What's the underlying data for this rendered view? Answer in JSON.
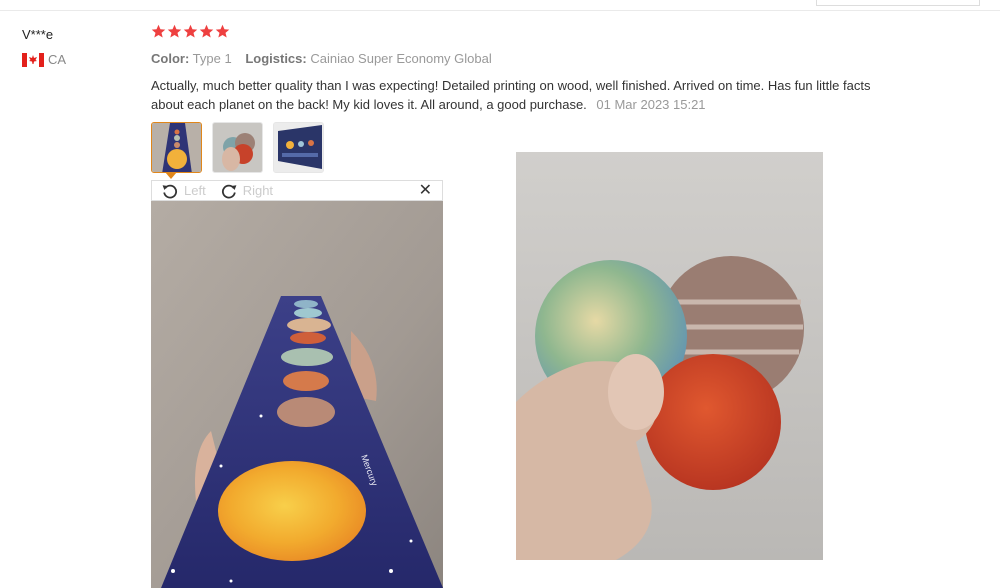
{
  "reviewer": {
    "name": "V***e",
    "country": "CA"
  },
  "review": {
    "rating": 5,
    "color_label": "Color:",
    "color_value": "Type 1",
    "logistics_label": "Logistics:",
    "logistics_value": "Cainiao Super Economy Global",
    "text": "Actually, much better quality than I was expecting! Detailed printing on wood, well finished. Arrived on time. Has fun little facts about each planet on the back! My kid loves it. All around, a good purchase.",
    "date": "01 Mar 2023 15:21"
  },
  "viewer": {
    "left_label": "Left",
    "right_label": "Right",
    "close_label": "✕"
  },
  "colors": {
    "star": "#ee4040",
    "accent": "#e0861a"
  }
}
